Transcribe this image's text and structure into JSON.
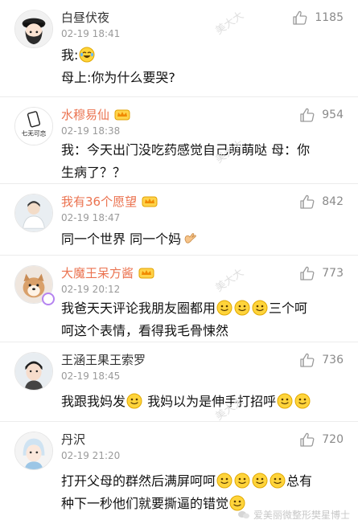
{
  "comments": [
    {
      "name": "白昼伏夜",
      "vip": false,
      "time": "02-19 18:41",
      "likes": "1185",
      "lines": [
        "我:",
        "母上:你为什么要哭?"
      ]
    },
    {
      "name": "水穆易仙",
      "vip": true,
      "time": "02-19 18:38",
      "likes": "954",
      "lines": [
        "我：今天出门没吃药感觉自己萌萌哒 母：你",
        "生病了？？"
      ]
    },
    {
      "name": "我有36个愿望",
      "vip": true,
      "time": "02-19 18:47",
      "likes": "842",
      "lines": [
        "同一个世界 同一个妈"
      ]
    },
    {
      "name": "大魔王呆方酱",
      "vip": true,
      "time": "02-19 20:12",
      "likes": "773",
      "lines": [
        "我爸天天评论我朋友圈都用",
        "三个呵",
        "呵这个表情，看得我毛骨悚然"
      ]
    },
    {
      "name": "王涵王果王索罗",
      "vip": false,
      "time": "02-19 18:45",
      "likes": "736",
      "lines": [
        "我跟我妈发",
        "我妈以为是伸手打招呼"
      ]
    },
    {
      "name": "丹沢",
      "vip": false,
      "time": "02-19 21:20",
      "likes": "720",
      "lines": [
        "打开父母的群然后满屏呵呵",
        "总有",
        "种下一秒他们就要撕逼的错觉"
      ]
    }
  ],
  "watermark": {
    "diagonal": "美大大",
    "footer": "爱美丽微整形樊星博士"
  },
  "icons": {
    "like": "thumbs-up-outline-icon",
    "crown": "vip-crown-icon",
    "emoji_smile": "smiling-face-emoji-icon",
    "emoji_laugh_cry": "laughing-tears-emoji-icon",
    "emoji_wave": "waving-hand-emoji-icon"
  },
  "colors": {
    "vip_name": "#eb7350",
    "timestamp": "#9a9a9a",
    "like_count": "#8a8a8a",
    "divider": "#ececec"
  }
}
